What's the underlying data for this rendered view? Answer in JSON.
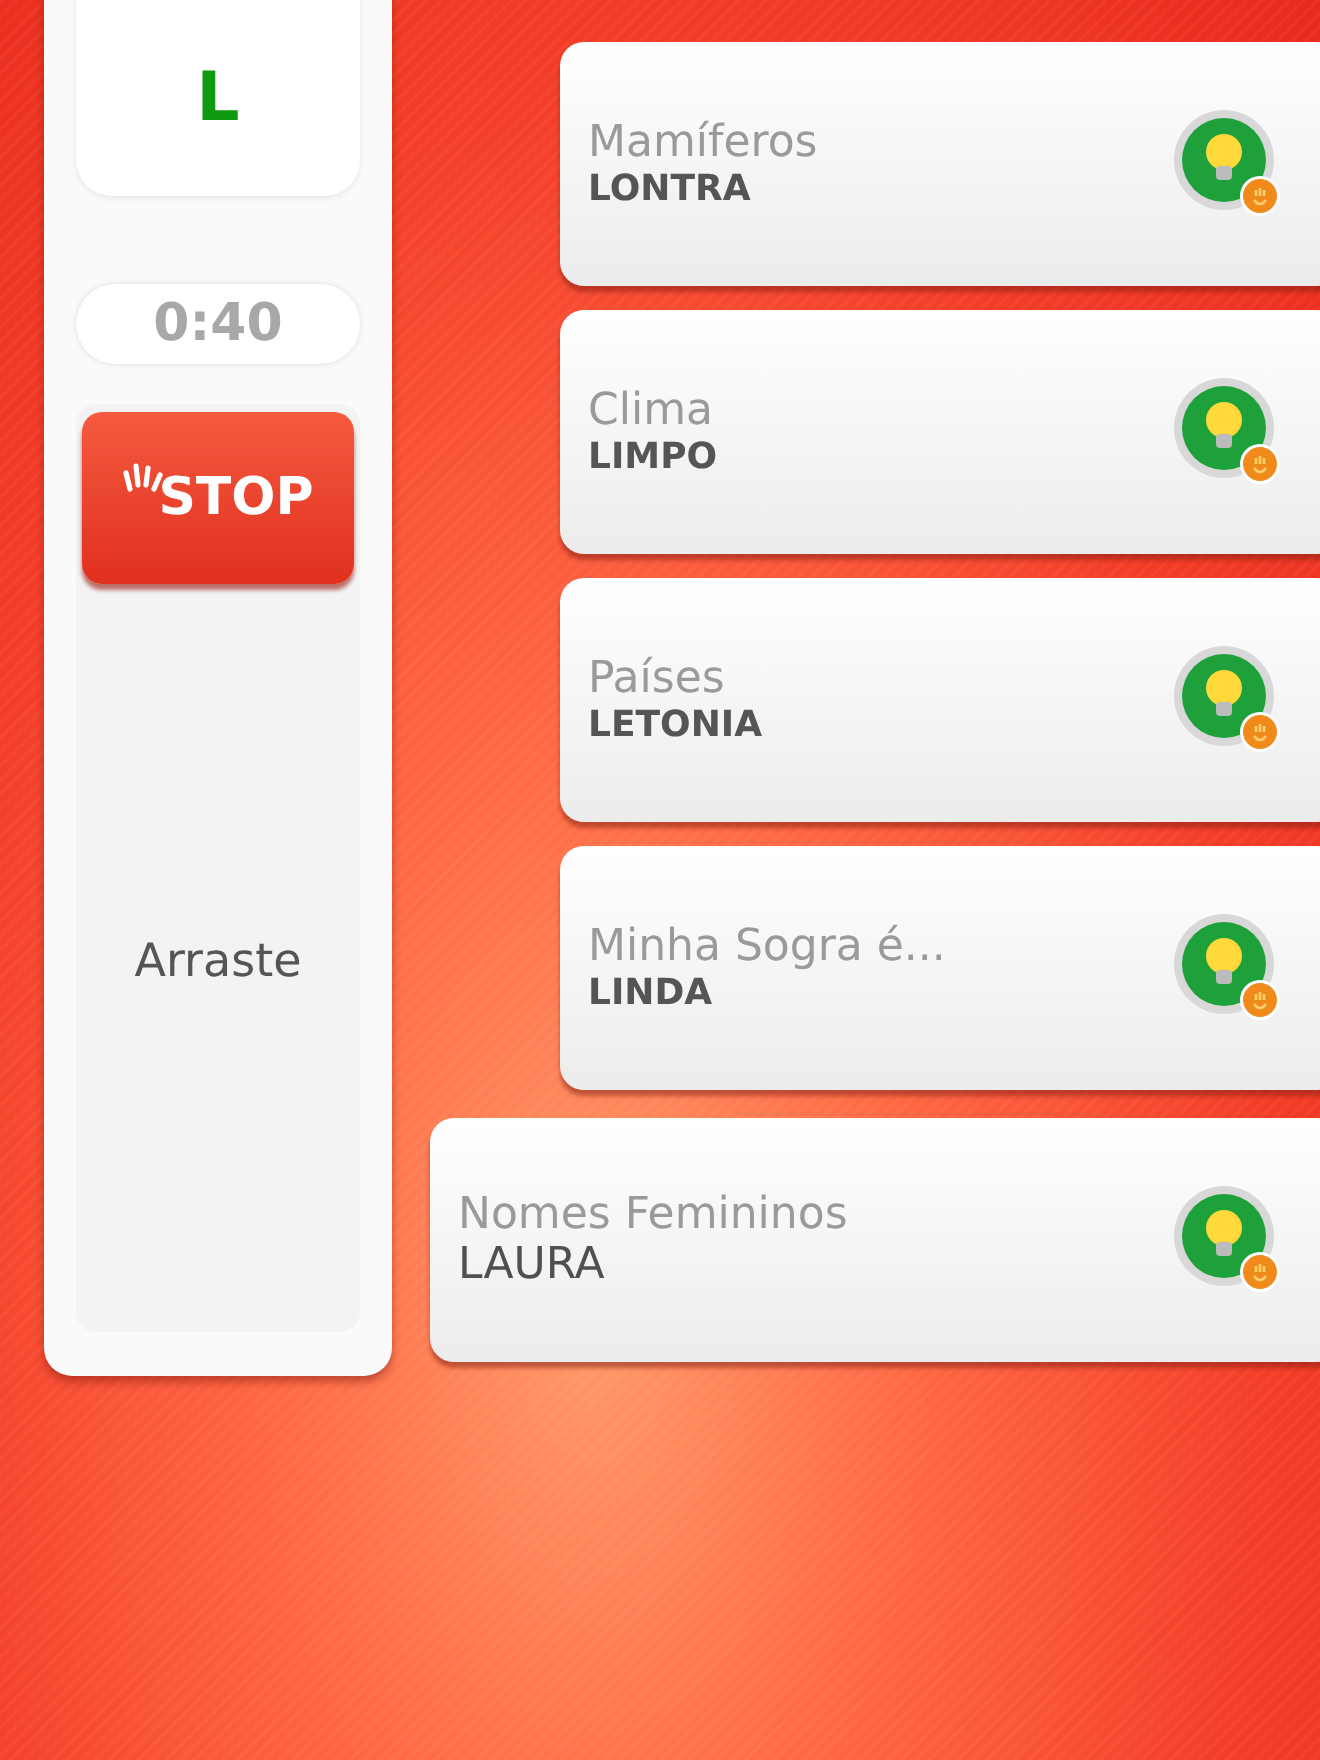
{
  "letter": "L",
  "timer": "0:40",
  "stop_button": {
    "label": "STOP"
  },
  "drag_hint": "Arraste",
  "categories": [
    {
      "category": "Mamíferos",
      "answer": "LONTRA",
      "selected": false
    },
    {
      "category": "Clima",
      "answer": "LIMPO",
      "selected": false
    },
    {
      "category": "Países",
      "answer": "LETONIA",
      "selected": false
    },
    {
      "category": "Minha Sogra é...",
      "answer": "LINDA",
      "selected": false
    },
    {
      "category": "Nomes Femininos",
      "answer": "LAURA",
      "selected": true
    }
  ]
}
